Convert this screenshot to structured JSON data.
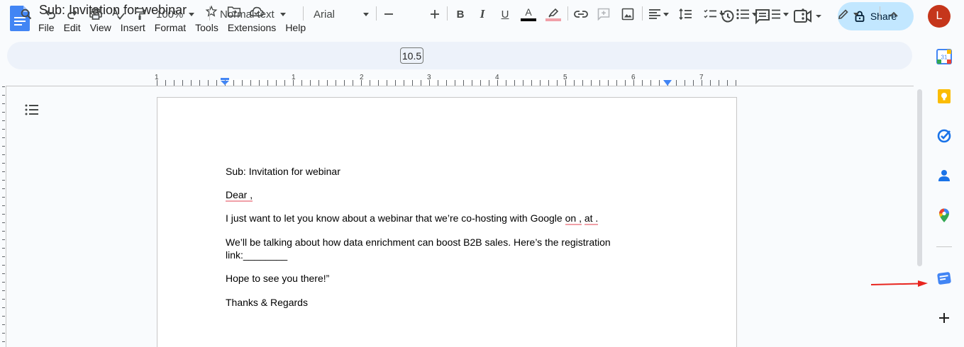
{
  "app": {
    "doc_title": "Sub: Invitation for webinar"
  },
  "menu": [
    "File",
    "Edit",
    "View",
    "Insert",
    "Format",
    "Tools",
    "Extensions",
    "Help"
  ],
  "header": {
    "share_label": "Share",
    "avatar_initial": "L"
  },
  "toolbar": {
    "zoom": "100%",
    "style": "Normal text",
    "font": "Arial",
    "font_size": "10.5",
    "text_color": "#000000",
    "highlight_color": "#f0a0a8"
  },
  "ruler": {
    "labels": [
      "1",
      "1",
      "2",
      "3",
      "4",
      "5",
      "6",
      "7"
    ]
  },
  "document": {
    "line1": "Sub: Invitation for webinar",
    "line2": "Dear ,",
    "line3_pre": "I just want to let you know about a webinar that we’re co-hosting with Google ",
    "line3_on": "on ,",
    "line3_at": "at .",
    "line4a": "We’ll be talking about how data enrichment can boost B2B sales. Here’s the registration",
    "line4b": "link:________",
    "line5": "Hope to see you there!”",
    "line6": "Thanks & Regards"
  },
  "side_panel": {
    "icons": [
      "calendar-icon",
      "keep-icon",
      "tasks-icon",
      "contacts-icon",
      "maps-icon",
      "addon-icon",
      "add-icon"
    ]
  },
  "colors": {
    "accent": "#c2e7ff",
    "brand_blue": "#4285f4",
    "avatar_bg": "#c5361b",
    "annotation_arrow": "#e8251f"
  }
}
